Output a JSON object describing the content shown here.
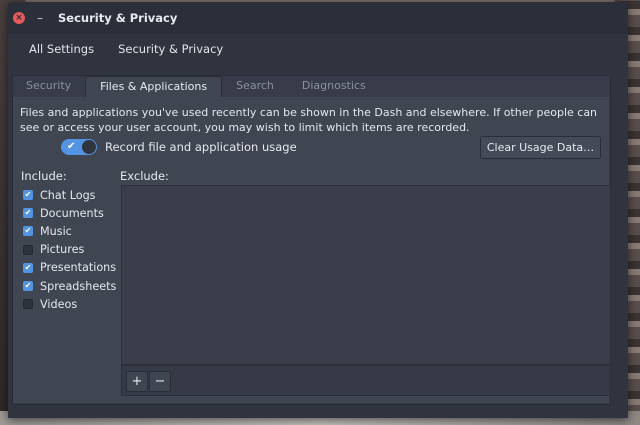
{
  "window": {
    "title": "Security & Privacy",
    "close_glyph": "×",
    "minimize_glyph": "–"
  },
  "navbar": {
    "all_settings": "All Settings",
    "crumb": "Security & Privacy"
  },
  "tabs": [
    {
      "label": "Security",
      "active": false
    },
    {
      "label": "Files & Applications",
      "active": true
    },
    {
      "label": "Search",
      "active": false
    },
    {
      "label": "Diagnostics",
      "active": false
    }
  ],
  "content": {
    "description": "Files and applications you've used recently can be shown in the Dash and elsewhere. If other people can see or access your user account, you may wish to limit which items are recorded.",
    "record_toggle": {
      "label": "Record file and application usage",
      "on": true,
      "glyph": "✔"
    },
    "clear_button": "Clear Usage Data…",
    "include_label": "Include:",
    "exclude_label": "Exclude:",
    "include_items": [
      {
        "label": "Chat Logs",
        "checked": true
      },
      {
        "label": "Documents",
        "checked": true
      },
      {
        "label": "Music",
        "checked": true
      },
      {
        "label": "Pictures",
        "checked": false
      },
      {
        "label": "Presentations",
        "checked": true
      },
      {
        "label": "Spreadsheets",
        "checked": true
      },
      {
        "label": "Videos",
        "checked": false
      }
    ],
    "add_glyph": "+",
    "remove_glyph": "−"
  },
  "colors": {
    "accent": "#5294e2",
    "window_bg": "#2f343f",
    "content_bg": "#404552",
    "close": "#e55a5a"
  }
}
